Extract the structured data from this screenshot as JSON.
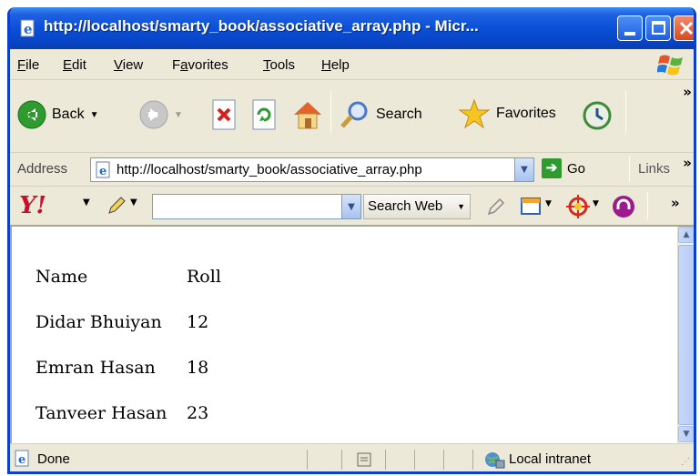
{
  "window": {
    "title": "http://localhost/smarty_book/associative_array.php - Micr..."
  },
  "menu": {
    "items": [
      {
        "pre": "",
        "u": "F",
        "post": "ile"
      },
      {
        "pre": "",
        "u": "E",
        "post": "dit"
      },
      {
        "pre": "",
        "u": "V",
        "post": "iew"
      },
      {
        "pre": "F",
        "u": "a",
        "post": "vorites"
      },
      {
        "pre": "",
        "u": "T",
        "post": "ools"
      },
      {
        "pre": "",
        "u": "H",
        "post": "elp"
      }
    ]
  },
  "toolbar": {
    "back_label": "Back",
    "search_label": "Search",
    "favorites_label": "Favorites",
    "overflow": "»"
  },
  "address": {
    "label": "Address",
    "url": "http://localhost/smarty_book/associative_array.php",
    "go_label": "Go",
    "links_label": "Links",
    "overflow": "»"
  },
  "yahoo": {
    "logo": "Y!",
    "search_placeholder": "",
    "search_web_label": "Search Web",
    "overflow": "»"
  },
  "table": {
    "rows": [
      [
        "Name",
        "Roll"
      ],
      [
        "Didar Bhuiyan",
        "12"
      ],
      [
        "Emran Hasan",
        "18"
      ],
      [
        "Tanveer Hasan",
        "23"
      ]
    ]
  },
  "status": {
    "text": "Done",
    "zone": "Local intranet"
  },
  "colors": {
    "title_blue": "#0a50d8",
    "go_green": "#2f9a2f"
  }
}
